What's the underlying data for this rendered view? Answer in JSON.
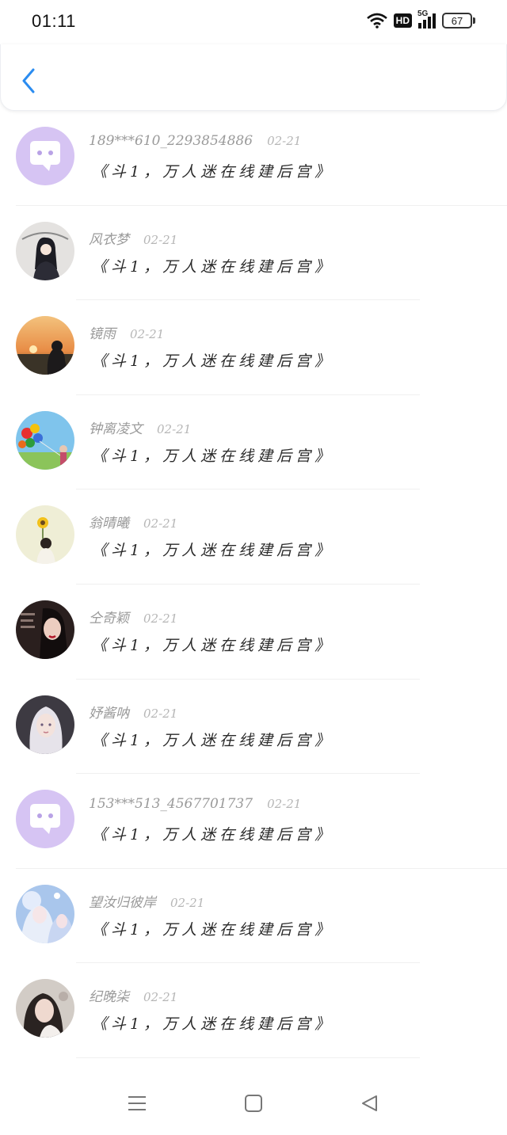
{
  "status_bar": {
    "time": "01:11",
    "hd_label": "HD",
    "network_label": "5G",
    "battery_level": "67"
  },
  "header": {
    "back_icon": "chevron-left-icon",
    "accent_color": "#2b8cf0"
  },
  "messages": [
    {
      "name": "189***610_2293854886",
      "time": "02-21",
      "text": "《斗1，万人迷在线建后宫》",
      "avatar": "default-chat"
    },
    {
      "name": "风衣梦",
      "time": "02-21",
      "text": "《斗1，万人迷在线建后宫》",
      "avatar": "photo-1"
    },
    {
      "name": "镜雨",
      "time": "02-21",
      "text": "《斗1，万人迷在线建后宫》",
      "avatar": "photo-2"
    },
    {
      "name": "钟离凌文",
      "time": "02-21",
      "text": "《斗1，万人迷在线建后宫》",
      "avatar": "photo-3"
    },
    {
      "name": "翁晴曦",
      "time": "02-21",
      "text": "《斗1，万人迷在线建后宫》",
      "avatar": "photo-4"
    },
    {
      "name": "仝奇颖",
      "time": "02-21",
      "text": "《斗1，万人迷在线建后宫》",
      "avatar": "photo-5"
    },
    {
      "name": "妤酱呐",
      "time": "02-21",
      "text": "《斗1，万人迷在线建后宫》",
      "avatar": "photo-6"
    },
    {
      "name": "153***513_4567701737",
      "time": "02-21",
      "text": "《斗1，万人迷在线建后宫》",
      "avatar": "default-chat"
    },
    {
      "name": "望汝归彼岸",
      "time": "02-21",
      "text": "《斗1，万人迷在线建后宫》",
      "avatar": "photo-7"
    },
    {
      "name": "纪晚柒",
      "time": "02-21",
      "text": "《斗1，万人迷在线建后宫》",
      "avatar": "photo-8"
    }
  ],
  "nav_bar": {
    "menu_icon": "menu-icon",
    "home_icon": "home-square-icon",
    "back_icon": "back-triangle-icon"
  }
}
